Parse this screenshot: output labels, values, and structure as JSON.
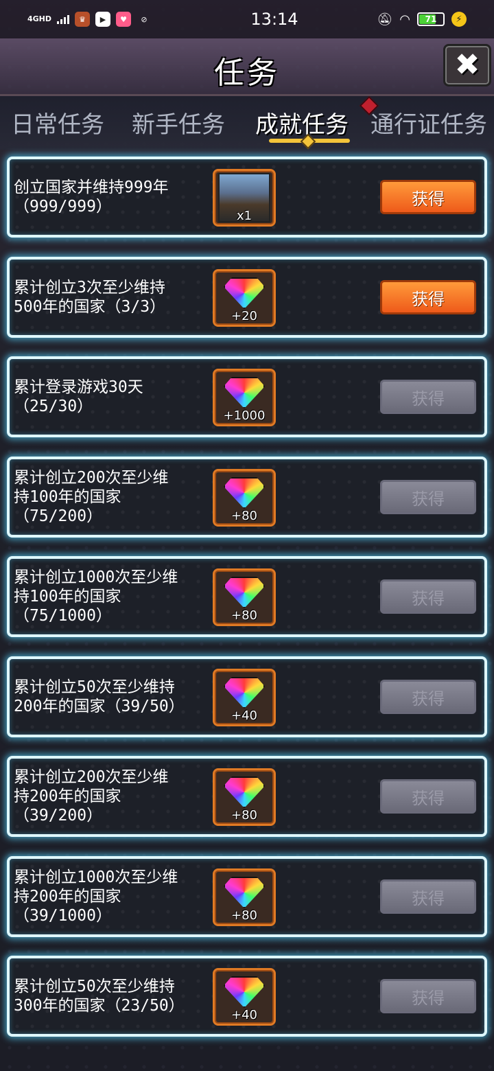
{
  "status_bar": {
    "network": "4GHD",
    "time": "13:14",
    "battery": "71",
    "battery_level": 0.71,
    "icons": [
      "signal-icon",
      "game-app-icon",
      "video-app-icon",
      "pink-app-icon",
      "link-app-icon",
      "mute-icon",
      "wifi-icon",
      "battery-icon",
      "charging-icon"
    ]
  },
  "header": {
    "title": "任务",
    "close_label": "✖"
  },
  "tabs": [
    {
      "label": "日常任务",
      "active": false
    },
    {
      "label": "新手任务",
      "active": false
    },
    {
      "label": "成就任务",
      "active": true
    },
    {
      "label": "通行证任务",
      "active": false
    }
  ],
  "tasks": [
    {
      "lines": [
        "创立国家并维持999年",
        "（999/999）"
      ],
      "reward_icon": "portrait-icon",
      "reward_qty": "x1",
      "button": "获得",
      "claimable": true
    },
    {
      "lines": [
        "累计创立3次至少维持",
        "500年的国家（3/3）"
      ],
      "reward_icon": "gem-icon",
      "reward_qty": "+20",
      "button": "获得",
      "claimable": true
    },
    {
      "lines": [
        "累计登录游戏30天",
        "（25/30）"
      ],
      "reward_icon": "gem-icon",
      "reward_qty": "+1000",
      "button": "获得",
      "claimable": false
    },
    {
      "lines": [
        "累计创立200次至少维",
        "持100年的国家",
        "（75/200）"
      ],
      "reward_icon": "gem-icon",
      "reward_qty": "+80",
      "button": "获得",
      "claimable": false
    },
    {
      "lines": [
        "累计创立1000次至少维",
        "持100年的国家",
        "（75/1000）"
      ],
      "reward_icon": "gem-icon",
      "reward_qty": "+80",
      "button": "获得",
      "claimable": false
    },
    {
      "lines": [
        "累计创立50次至少维持",
        "200年的国家（39/50）"
      ],
      "reward_icon": "gem-icon",
      "reward_qty": "+40",
      "button": "获得",
      "claimable": false
    },
    {
      "lines": [
        "累计创立200次至少维",
        "持200年的国家",
        "（39/200）"
      ],
      "reward_icon": "gem-icon",
      "reward_qty": "+80",
      "button": "获得",
      "claimable": false
    },
    {
      "lines": [
        "累计创立1000次至少维",
        "持200年的国家",
        "（39/1000）"
      ],
      "reward_icon": "gem-icon",
      "reward_qty": "+80",
      "button": "获得",
      "claimable": false
    },
    {
      "lines": [
        "累计创立50次至少维持",
        "300年的国家（23/50）"
      ],
      "reward_icon": "gem-icon",
      "reward_qty": "+40",
      "button": "获得",
      "claimable": false
    }
  ]
}
